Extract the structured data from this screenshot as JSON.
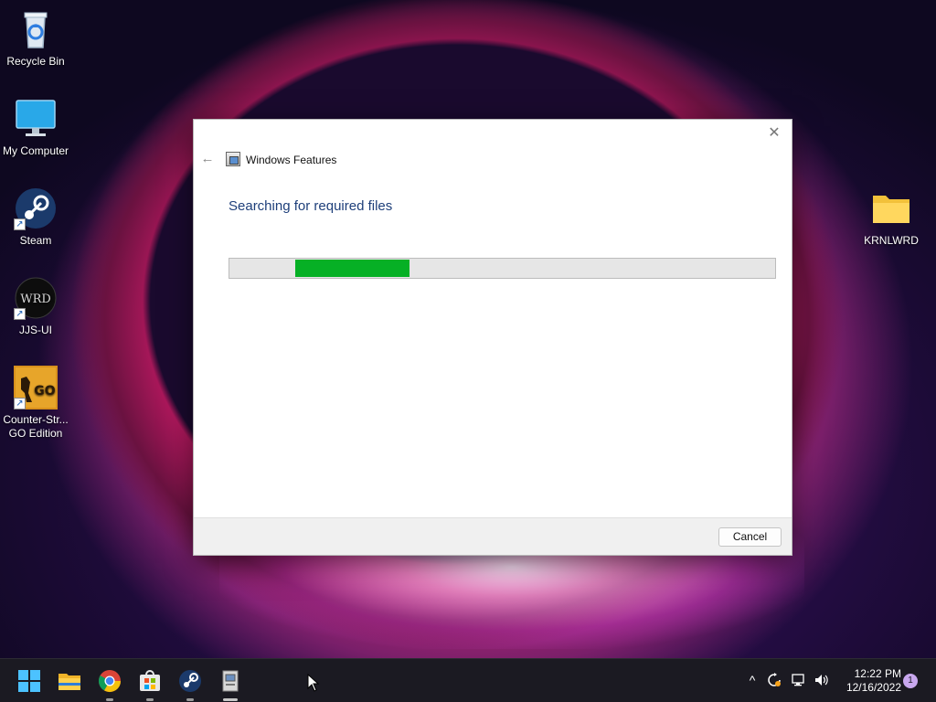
{
  "desktop": {
    "icons": [
      {
        "label": "Recycle Bin",
        "icon": "recycle-bin-icon"
      },
      {
        "label": "My Computer",
        "icon": "monitor-icon"
      },
      {
        "label": "Steam",
        "icon": "steam-icon"
      },
      {
        "label": "JJS-UI",
        "icon": "wrd-icon"
      },
      {
        "label": "Counter-Str... GO Edition",
        "icon": "csgo-icon"
      },
      {
        "label": "KRNLWRD",
        "icon": "folder-icon"
      }
    ]
  },
  "dialog": {
    "title": "Windows Features",
    "heading": "Searching for required files",
    "progress": {
      "fill_start_fraction": 0.12,
      "fill_end_fraction": 0.33
    },
    "cancel_label": "Cancel",
    "close_glyph": "✕",
    "back_glyph": "←",
    "accent_color": "#06b025"
  },
  "taskbar": {
    "apps": [
      "start-icon",
      "file-explorer-icon",
      "chrome-icon",
      "store-icon",
      "steam-icon",
      "windows-features-icon"
    ],
    "time": "12:22 PM",
    "date": "12/16/2022",
    "notification_count": "1",
    "tray_chevron": "^"
  }
}
